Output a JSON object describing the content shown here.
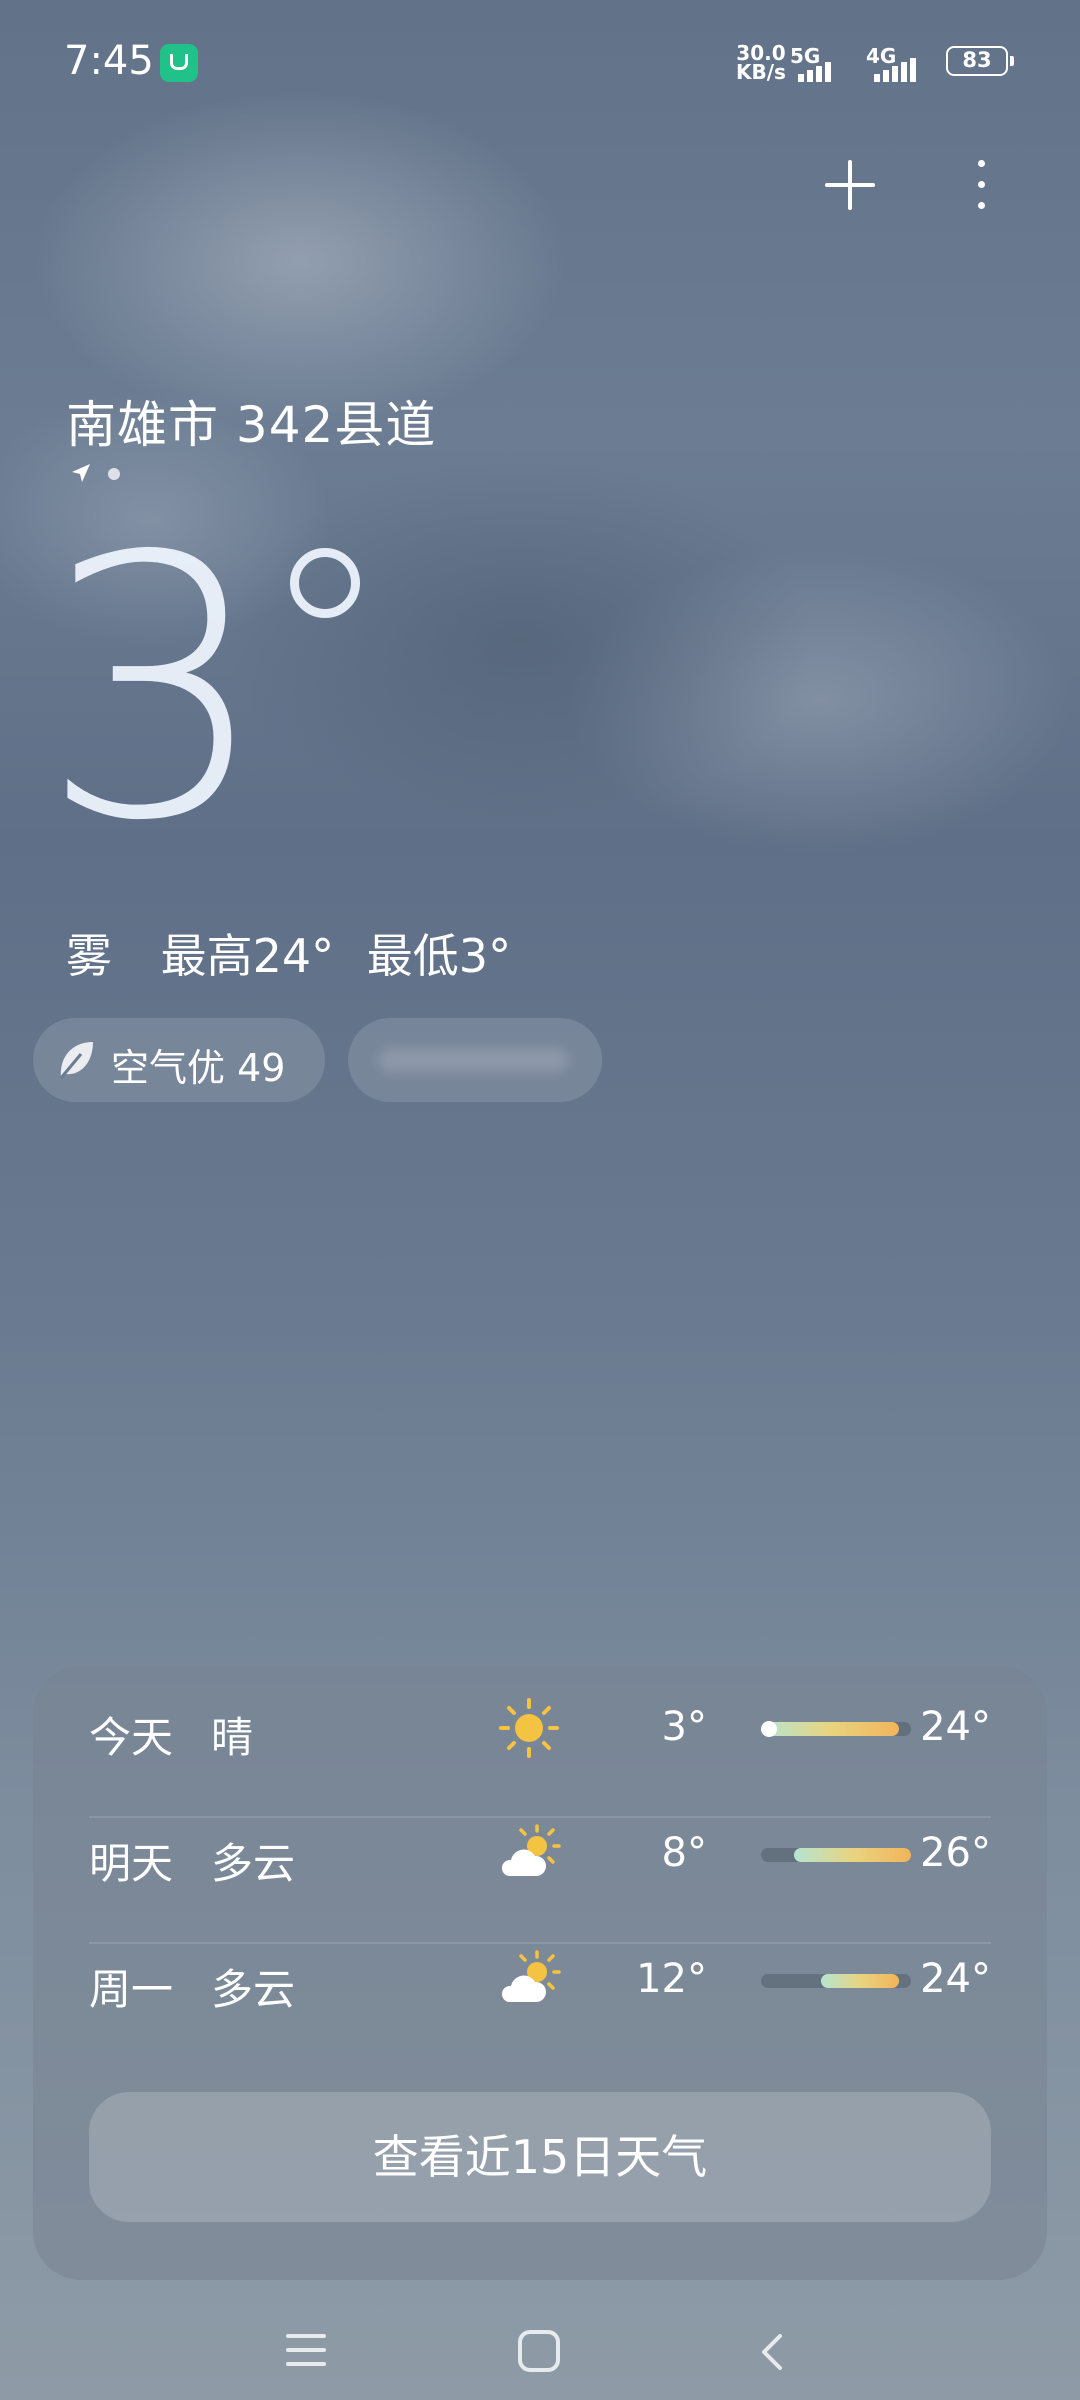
{
  "status_bar": {
    "time": "7:45",
    "net_speed_value": "30.0",
    "net_speed_unit": "KB/s",
    "signal_1_label": "5G",
    "signal_2_label": "4G",
    "battery": "83"
  },
  "header": {
    "add_icon": "plus-icon",
    "more_icon": "more-vertical-icon"
  },
  "location": {
    "name": "南雄市 342县道"
  },
  "current": {
    "temperature": "3",
    "condition": "雾",
    "high": "最高24°",
    "low": "最低3°"
  },
  "pills": {
    "aqi_label": "空气优 49"
  },
  "forecast": [
    {
      "day": "今天",
      "condition": "晴",
      "icon": "sun-icon",
      "low": "3°",
      "high": "24°",
      "bar_start": 0.0,
      "bar_end": 0.92,
      "current_marker": 0.0
    },
    {
      "day": "明天",
      "condition": "多云",
      "icon": "partly-cloudy-icon",
      "low": "8°",
      "high": "26°",
      "bar_start": 0.22,
      "bar_end": 1.0
    },
    {
      "day": "周一",
      "condition": "多云",
      "icon": "partly-cloudy-icon",
      "low": "12°",
      "high": "24°",
      "bar_start": 0.4,
      "bar_end": 0.92
    }
  ],
  "more_button": "查看近15日天气",
  "colors": {
    "sun": "#f5c342",
    "bar_gradient_start": "#b4e5d2",
    "bar_gradient_end": "#f2b45a"
  }
}
